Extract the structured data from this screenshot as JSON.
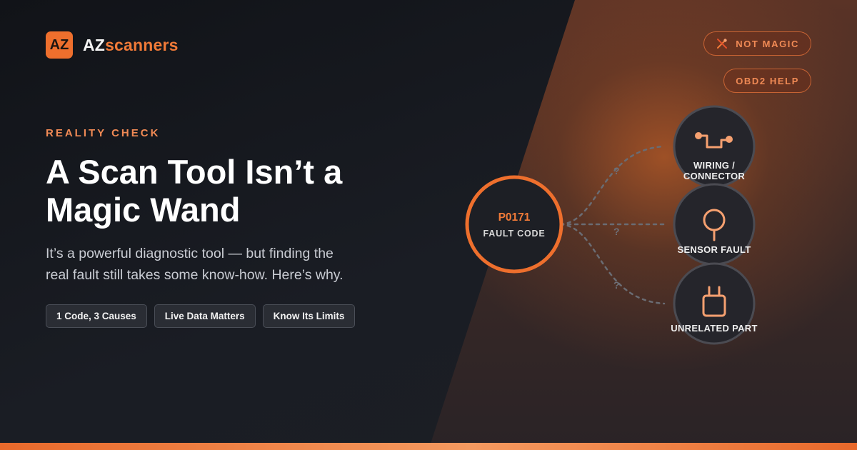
{
  "brand": {
    "mark": "AZ",
    "name_white": "AZ",
    "name_orange": "scanners"
  },
  "badges": [
    {
      "label": "NOT MAGIC",
      "icon": "no-magic-wand-icon"
    },
    {
      "label": "OBD2 HELP"
    }
  ],
  "hero": {
    "eyebrow": "REALITY CHECK",
    "headline_line1": "A Scan Tool Isn’t a",
    "headline_line2": "Magic Wand",
    "subtitle_line1": "It’s a powerful diagnostic tool — but finding the",
    "subtitle_line2": "real fault still takes some know-how. Here’s why."
  },
  "tags": [
    "1 Code, 3 Causes",
    "Live Data Matters",
    "Know Its Limits"
  ],
  "diagram": {
    "code": "P0171",
    "code_label": "FAULT CODE",
    "unknown_mark": "?",
    "causes": [
      {
        "label_line1": "WIRING /",
        "label_line2": "CONNECTOR",
        "icon": "wiring-icon"
      },
      {
        "label_line1": "SENSOR FAULT",
        "label_line2": "",
        "icon": "sensor-icon"
      },
      {
        "label_line1": "UNRELATED PART",
        "label_line2": "",
        "icon": "plug-icon"
      }
    ]
  },
  "colors": {
    "accent": "#ee6f2d",
    "accent_light": "#f08a55",
    "background": "#15171c"
  }
}
